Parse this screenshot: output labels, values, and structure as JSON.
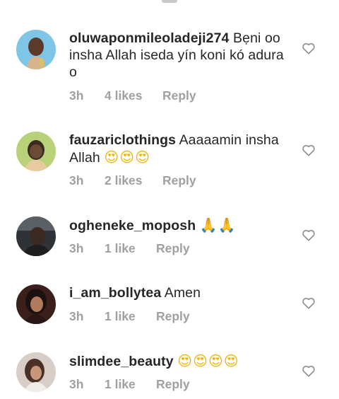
{
  "comments": [
    {
      "username": "oluwaponmileoladeji274",
      "text": " Bẹni oo insha Allah iseda yín koni kó adura o",
      "emoji": "",
      "time": "3h",
      "likes": "4 likes",
      "reply": "Reply",
      "avatar_icon": "user-avatar"
    },
    {
      "username": "fauzariclothings",
      "text": " Aaaaamin insha Allah ",
      "emoji": "😍😍😍",
      "time": "3h",
      "likes": "2 likes",
      "reply": "Reply",
      "avatar_icon": "user-avatar"
    },
    {
      "username": "ogheneke_moposh",
      "text": " ",
      "emoji": "🙏🙏",
      "time": "3h",
      "likes": "1 like",
      "reply": "Reply",
      "avatar_icon": "user-avatar"
    },
    {
      "username": "i_am_bollytea",
      "text": " Amen",
      "emoji": "",
      "time": "3h",
      "likes": "1 like",
      "reply": "Reply",
      "avatar_icon": "user-avatar"
    },
    {
      "username": "slimdee_beauty",
      "text": " ",
      "emoji": "😍😍😍😍",
      "time": "3h",
      "likes": "1 like",
      "reply": "Reply",
      "avatar_icon": "user-avatar"
    }
  ],
  "colors": {
    "text": "#262626",
    "meta": "#a0a0a0",
    "heart_stroke": "#8e8e8e"
  }
}
